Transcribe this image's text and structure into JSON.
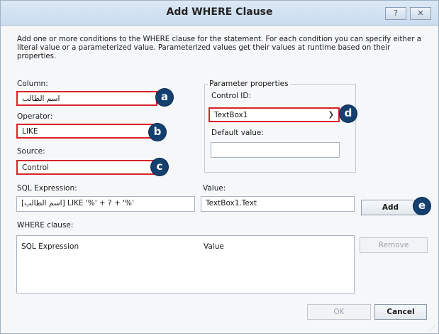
{
  "window": {
    "title": "Add WHERE Clause",
    "help_icon": "?",
    "close_icon": "✕"
  },
  "intro_text": "Add one or more conditions to the WHERE clause for the statement. For each condition you can specify either a literal value or a parameterized value. Parameterized values get their values at runtime based on their properties.",
  "column": {
    "label": "Column:",
    "value": "اسم الطالب"
  },
  "operator": {
    "label": "Operator:",
    "value": "LIKE"
  },
  "source": {
    "label": "Source:",
    "value": "Control"
  },
  "parameter_properties": {
    "legend": "Parameter properties",
    "control_id_label": "Control ID:",
    "control_id_value": "TextBox1",
    "default_value_label": "Default value:",
    "default_value": ""
  },
  "sql_expression": {
    "label": "SQL Expression:",
    "value": "[اسم الطالب] LIKE '%' + ? + '%'"
  },
  "value": {
    "label": "Value:",
    "value": "TextBox1.Text"
  },
  "add_button": "Add",
  "where_clause": {
    "label": "WHERE clause:",
    "columns": [
      "SQL Expression",
      "Value"
    ]
  },
  "remove_button": "Remove",
  "ok_button": "OK",
  "cancel_button": "Cancel",
  "badges": {
    "a": "a",
    "b": "b",
    "c": "c",
    "d": "d",
    "e": "e"
  },
  "colors": {
    "highlight": "#d9232a",
    "badge": "#13406f",
    "titlebar": "#c9dcef"
  }
}
